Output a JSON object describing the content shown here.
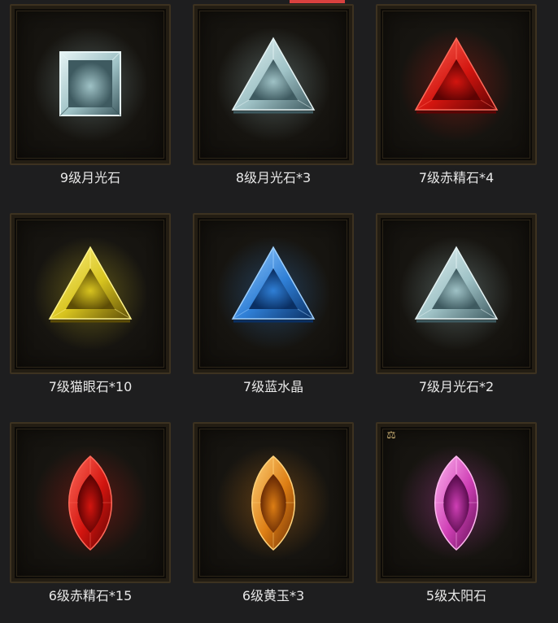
{
  "items": [
    {
      "label": "9级月光石",
      "shape": "square",
      "color": "moon",
      "icon": "square-moonstone-icon"
    },
    {
      "label": "8级月光石*3",
      "shape": "triangle",
      "color": "moon",
      "icon": "triangle-moonstone-icon"
    },
    {
      "label": "7级赤精石*4",
      "shape": "triangle",
      "color": "red",
      "icon": "triangle-red-gem-icon"
    },
    {
      "label": "7级猫眼石*10",
      "shape": "triangle",
      "color": "yellow",
      "icon": "triangle-cats-eye-icon"
    },
    {
      "label": "7级蓝水晶",
      "shape": "triangle",
      "color": "blue",
      "icon": "triangle-blue-crystal-icon"
    },
    {
      "label": "7级月光石*2",
      "shape": "triangle",
      "color": "moon",
      "icon": "triangle-moonstone-icon"
    },
    {
      "label": "6级赤精石*15",
      "shape": "marquise",
      "color": "red",
      "icon": "marquise-red-gem-icon"
    },
    {
      "label": "6级黄玉*3",
      "shape": "marquise",
      "color": "orange",
      "icon": "marquise-topaz-icon"
    },
    {
      "label": "5级太阳石",
      "shape": "marquise",
      "color": "purple",
      "icon": "marquise-sunstone-icon",
      "badge": "⚖",
      "badge_icon": "scales-icon"
    }
  ],
  "colors": {
    "moon": {
      "light": "#e6f4f5",
      "mid": "#9fc2c6",
      "dark": "#3e5a60"
    },
    "red": {
      "light": "#ff6a5a",
      "mid": "#d3150f",
      "dark": "#5e0303"
    },
    "yellow": {
      "light": "#fff48a",
      "mid": "#d8c41f",
      "dark": "#5d4d06"
    },
    "blue": {
      "light": "#9ed0ff",
      "mid": "#2f7fd6",
      "dark": "#0a2f63"
    },
    "orange": {
      "light": "#ffd27a",
      "mid": "#dd7e14",
      "dark": "#6a2b04"
    },
    "purple": {
      "light": "#ffb8f0",
      "mid": "#cf3fb5",
      "dark": "#5a0c4e"
    }
  }
}
